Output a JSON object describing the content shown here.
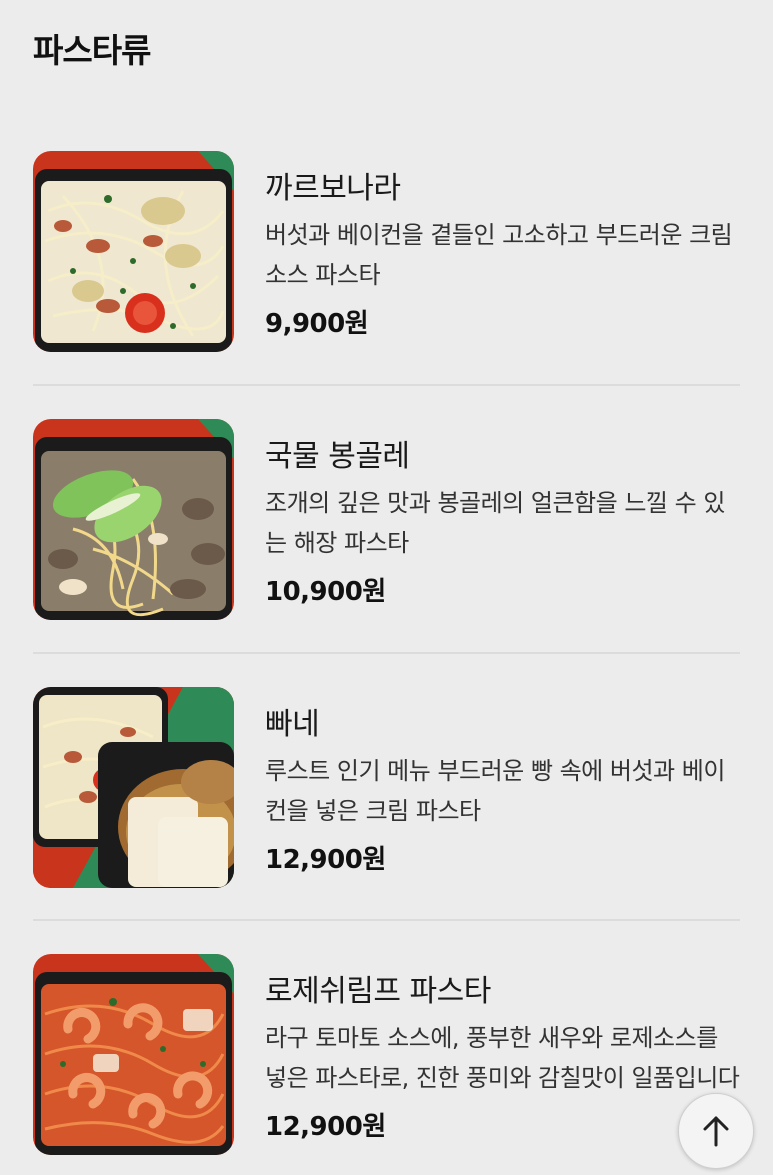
{
  "section": {
    "title": "파스타류"
  },
  "menu_items": [
    {
      "name": "까르보나라",
      "description": "버섯과 베이컨을 곁들인 고소하고 부드러운 크림 소스 파스타",
      "price": "9,900원",
      "image": "carbonara-photo"
    },
    {
      "name": "국물 봉골레",
      "description": "조개의 깊은 맛과 봉골레의 얼큰함을 느낄 수 있는 해장 파스타",
      "price": "10,900원",
      "image": "vongole-photo"
    },
    {
      "name": "빠네",
      "description": "루스트 인기 메뉴 부드러운 빵 속에 버섯과 베이컨을 넣은 크림 파스타",
      "price": "12,900원",
      "image": "panne-photo"
    },
    {
      "name": "로제쉬림프 파스타",
      "description": "라구 토마토 소스에, 풍부한 새우와 로제소스를 넣은 파스타로, 진한 풍미와 감칠맛이 일품입니다",
      "price": "12,900원",
      "image": "rose-shrimp-photo"
    }
  ],
  "scroll_top_button": {
    "icon": "arrow-up-icon"
  },
  "colors": {
    "background": "#ececec",
    "divider": "#dcdcdc",
    "tray_red": "#c8341c",
    "tray_green": "#2e8b57"
  }
}
